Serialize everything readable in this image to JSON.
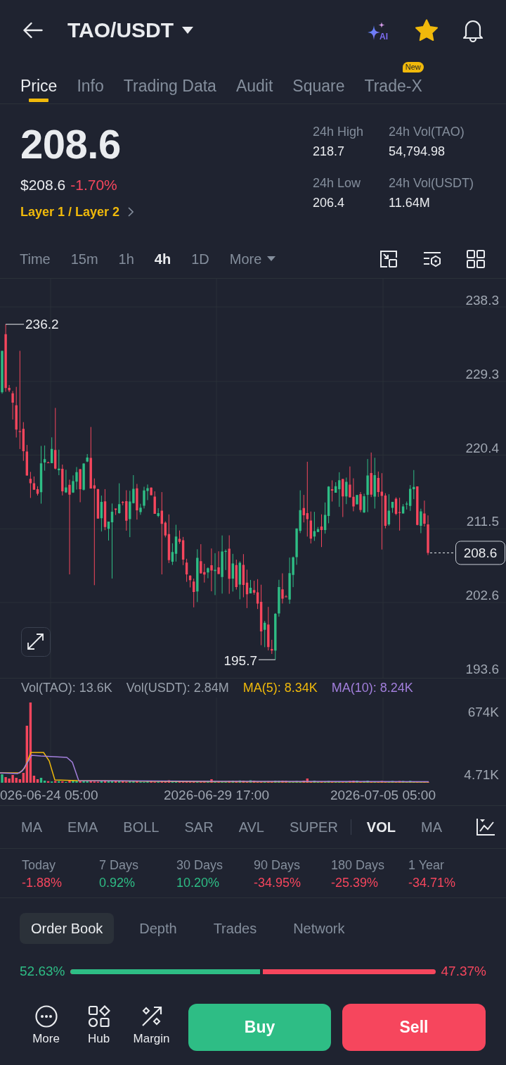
{
  "header": {
    "pair": "TAO/USDT",
    "ai_label": "AI",
    "favorite": true
  },
  "tabs": [
    {
      "label": "Price",
      "selected": true
    },
    {
      "label": "Info",
      "selected": false
    },
    {
      "label": "Trading Data",
      "selected": false
    },
    {
      "label": "Audit",
      "selected": false
    },
    {
      "label": "Square",
      "selected": false
    },
    {
      "label": "Trade-X",
      "selected": false,
      "badge": "New"
    }
  ],
  "price": {
    "last": "208.6",
    "usd": "$208.6",
    "change": "-1.70%",
    "falling": true,
    "sector": "Layer 1 / Layer 2"
  },
  "stats": [
    {
      "label": "24h High",
      "value": "218.7"
    },
    {
      "label": "24h Vol(TAO)",
      "value": "54,794.98"
    },
    {
      "label": "24h Low",
      "value": "206.4"
    },
    {
      "label": "24h Vol(USDT)",
      "value": "11.64M"
    }
  ],
  "intervals": [
    {
      "label": "Time",
      "selected": false,
      "kind": "option"
    },
    {
      "label": "15m",
      "selected": false,
      "kind": "option"
    },
    {
      "label": "1h",
      "selected": false,
      "kind": "option"
    },
    {
      "label": "4h",
      "selected": true,
      "kind": "option"
    },
    {
      "label": "1D",
      "selected": false,
      "kind": "option"
    },
    {
      "label": "More",
      "selected": false,
      "kind": "menu"
    }
  ],
  "chart": {
    "y_labels": [
      "238.3",
      "229.3",
      "220.4",
      "211.5",
      "202.6",
      "193.6"
    ],
    "high_marker": "236.2",
    "low_marker": "195.7",
    "last_price": "208.6"
  },
  "volume": {
    "legend": [
      {
        "label": "Vol(TAO): 13.6K",
        "color": "#9aa2ad"
      },
      {
        "label": "Vol(USDT): 2.84M",
        "color": "#9aa2ad"
      },
      {
        "label": "MA(5): 8.34K",
        "color": "#f0b90b"
      },
      {
        "label": "MA(10): 8.24K",
        "color": "#a27fdc"
      }
    ],
    "y_labels": [
      "674K",
      "4.71K"
    ],
    "dates": [
      "026-06-24 05:00",
      "2026-06-29 17:00",
      "2026-07-05 05:00"
    ]
  },
  "indicators": [
    {
      "label": "MA",
      "selected": false,
      "kind": "main"
    },
    {
      "label": "EMA",
      "selected": false,
      "kind": "main"
    },
    {
      "label": "BOLL",
      "selected": false,
      "kind": "main"
    },
    {
      "label": "SAR",
      "selected": false,
      "kind": "main"
    },
    {
      "label": "AVL",
      "selected": false,
      "kind": "main"
    },
    {
      "label": "SUPER",
      "selected": false,
      "kind": "main"
    },
    {
      "label": "VOL",
      "selected": true,
      "kind": "sub"
    },
    {
      "label": "MA",
      "selected": false,
      "kind": "sub"
    }
  ],
  "performance": [
    {
      "period": "Today",
      "change": "-1.88%",
      "falling": true
    },
    {
      "period": "7 Days",
      "change": "0.92%",
      "falling": false
    },
    {
      "period": "30 Days",
      "change": "10.20%",
      "falling": false
    },
    {
      "period": "90 Days",
      "change": "-34.95%",
      "falling": true
    },
    {
      "period": "180 Days",
      "change": "-25.39%",
      "falling": true
    },
    {
      "period": "1 Year",
      "change": "-34.71%",
      "falling": true
    }
  ],
  "book_tabs": [
    {
      "label": "Order Book",
      "selected": true
    },
    {
      "label": "Depth",
      "selected": false
    },
    {
      "label": "Trades",
      "selected": false
    },
    {
      "label": "Network",
      "selected": false
    }
  ],
  "ratio": {
    "buy": "52.63%",
    "sell": "47.37%",
    "level": 0.5263
  },
  "bottom_nav": [
    {
      "label": "More",
      "kind": "more"
    },
    {
      "label": "Hub",
      "kind": "hub"
    },
    {
      "label": "Margin",
      "kind": "margin"
    }
  ],
  "actions": [
    {
      "label": "Buy",
      "kind": "buy"
    },
    {
      "label": "Sell",
      "kind": "sell"
    }
  ]
}
